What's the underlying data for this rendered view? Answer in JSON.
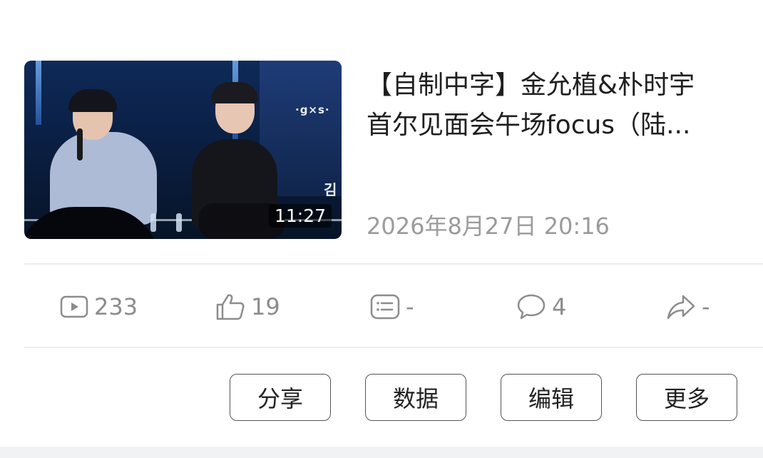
{
  "video": {
    "title_line1": "【自制中字】金允植&朴时宇",
    "title_line2": "首尔见面会午场focus（陆...",
    "date": "2026年8月27日 20:16",
    "duration": "11:27",
    "thumbnail": {
      "logo_text": "·g×s·",
      "sign_text": "김"
    }
  },
  "stats": {
    "views": {
      "icon": "play-icon",
      "value": "233"
    },
    "likes": {
      "icon": "thumbs-up-icon",
      "value": "19"
    },
    "danmaku": {
      "icon": "danmaku-icon",
      "value": "-"
    },
    "comments": {
      "icon": "comment-icon",
      "value": "4"
    },
    "shares": {
      "icon": "share-icon",
      "value": "-"
    }
  },
  "actions": {
    "share": "分享",
    "data": "数据",
    "edit": "编辑",
    "more": "更多"
  },
  "colors": {
    "stat_gray": "#8c8c8c",
    "date_gray": "#9b9b9b",
    "divider": "#ececec"
  }
}
